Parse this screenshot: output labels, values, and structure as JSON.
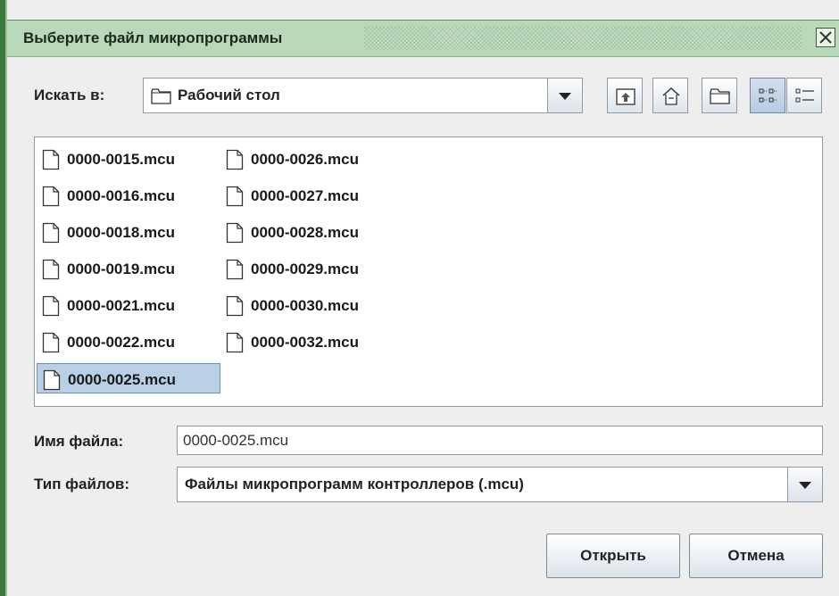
{
  "title": "Выберите файл микропрограммы",
  "lookin": {
    "label": "Искать в:",
    "value": "Рабочий стол",
    "icon": "folder-icon"
  },
  "toolbar": [
    "up-folder-icon",
    "home-icon",
    "new-folder-icon",
    "list-view-icon",
    "details-view-icon"
  ],
  "files": {
    "col1": [
      "0000-0015.mcu",
      "0000-0016.mcu",
      "0000-0018.mcu",
      "0000-0019.mcu",
      "0000-0021.mcu",
      "0000-0022.mcu",
      "0000-0025.mcu"
    ],
    "col2": [
      "0000-0026.mcu",
      "0000-0027.mcu",
      "0000-0028.mcu",
      "0000-0029.mcu",
      "0000-0030.mcu",
      "0000-0032.mcu"
    ],
    "selected": "0000-0025.mcu"
  },
  "filename": {
    "label": "Имя файла:",
    "value": "0000-0025.mcu"
  },
  "filetype": {
    "label": "Тип файлов:",
    "value": "Файлы микропрограмм контроллеров (.mcu)"
  },
  "buttons": {
    "open": "Открыть",
    "cancel": "Отмена"
  },
  "colors": {
    "titlebar": "#b9d7b9",
    "selection": "#b8cfe5",
    "dialog_bg": "#eeeeee"
  }
}
